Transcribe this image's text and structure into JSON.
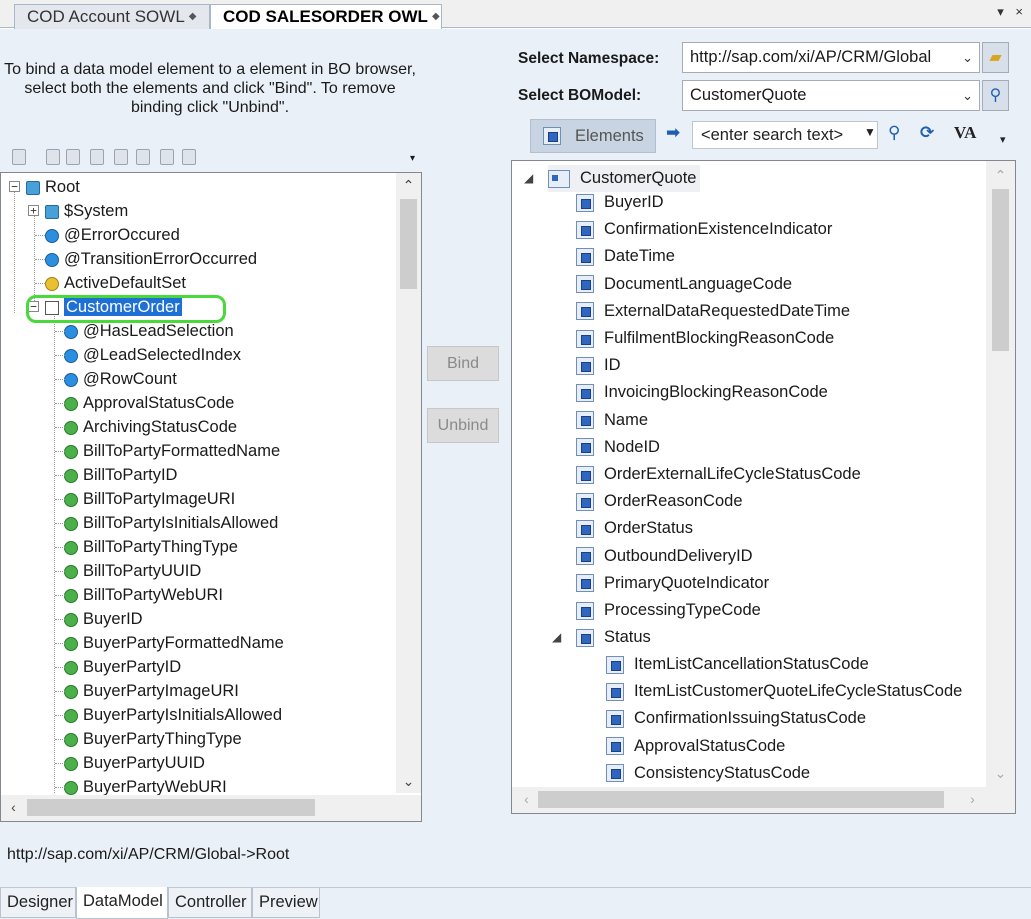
{
  "doc_tabs": [
    {
      "label": "COD Account SOWL",
      "active": false
    },
    {
      "label": "COD SALESORDER OWL",
      "active": true
    }
  ],
  "window_menu": {
    "dropdown_glyph": "▾",
    "close_glyph": "×"
  },
  "instructions": "To bind a data model element to a element in BO browser, select both the elements and click \"Bind\". To remove binding click \"Unbind\".",
  "data_model_tree": {
    "root": "Root",
    "system": "$System",
    "root_children": [
      {
        "label": "@ErrorOccured",
        "icon": "blue"
      },
      {
        "label": "@TransitionErrorOccurred",
        "icon": "blue"
      },
      {
        "label": "ActiveDefaultSet",
        "icon": "yellow"
      }
    ],
    "selected_node": "CustomerOrder",
    "customer_order_children": [
      {
        "label": "@HasLeadSelection",
        "icon": "blue"
      },
      {
        "label": "@LeadSelectedIndex",
        "icon": "blue"
      },
      {
        "label": "@RowCount",
        "icon": "blue"
      },
      {
        "label": "ApprovalStatusCode",
        "icon": "green"
      },
      {
        "label": "ArchivingStatusCode",
        "icon": "green"
      },
      {
        "label": "BillToPartyFormattedName",
        "icon": "green"
      },
      {
        "label": "BillToPartyID",
        "icon": "green"
      },
      {
        "label": "BillToPartyImageURI",
        "icon": "green"
      },
      {
        "label": "BillToPartyIsInitialsAllowed",
        "icon": "green"
      },
      {
        "label": "BillToPartyThingType",
        "icon": "green"
      },
      {
        "label": "BillToPartyUUID",
        "icon": "green"
      },
      {
        "label": "BillToPartyWebURI",
        "icon": "green"
      },
      {
        "label": "BuyerID",
        "icon": "green"
      },
      {
        "label": "BuyerPartyFormattedName",
        "icon": "green"
      },
      {
        "label": "BuyerPartyID",
        "icon": "green"
      },
      {
        "label": "BuyerPartyImageURI",
        "icon": "green"
      },
      {
        "label": "BuyerPartyIsInitialsAllowed",
        "icon": "green"
      },
      {
        "label": "BuyerPartyThingType",
        "icon": "green"
      },
      {
        "label": "BuyerPartyUUID",
        "icon": "green"
      },
      {
        "label": "BuyerPartyWebURI",
        "icon": "green"
      }
    ]
  },
  "actions": {
    "bind": "Bind",
    "unbind": "Unbind"
  },
  "namespace": {
    "label": "Select Namespace:",
    "value": "http://sap.com/xi/AP/CRM/Global"
  },
  "bo_model": {
    "label": "Select BOModel:",
    "value": "CustomerQuote"
  },
  "bo_toolbar": {
    "elements_label": "Elements",
    "search_placeholder": "<enter search text>",
    "va_label": "VA"
  },
  "bo_tree": {
    "root": "CustomerQuote",
    "elements": [
      "BuyerID",
      "ConfirmationExistenceIndicator",
      "DateTime",
      "DocumentLanguageCode",
      "ExternalDataRequestedDateTime",
      "FulfilmentBlockingReasonCode",
      "ID",
      "InvoicingBlockingReasonCode",
      "Name",
      "NodeID",
      "OrderExternalLifeCycleStatusCode",
      "OrderReasonCode",
      "OrderStatus",
      "OutboundDeliveryID",
      "PrimaryQuoteIndicator",
      "ProcessingTypeCode"
    ],
    "status_node": "Status",
    "status_children": [
      "ItemListCancellationStatusCode",
      "ItemListCustomerQuoteLifeCycleStatusCode",
      "ConfirmationIssuingStatusCode",
      "ApprovalStatusCode",
      "ConsistencyStatusCode"
    ]
  },
  "binding_path": "http://sap.com/xi/AP/CRM/Global->Root",
  "bottom_tabs": [
    {
      "label": "Designer",
      "active": false
    },
    {
      "label": "DataModel",
      "active": true
    },
    {
      "label": "Controller",
      "active": false
    },
    {
      "label": "Preview",
      "active": false
    }
  ],
  "colors": {
    "selection": "#1e6fd6",
    "highlight_ring": "#49d93a",
    "panel_bg": "#eaf0f7"
  }
}
